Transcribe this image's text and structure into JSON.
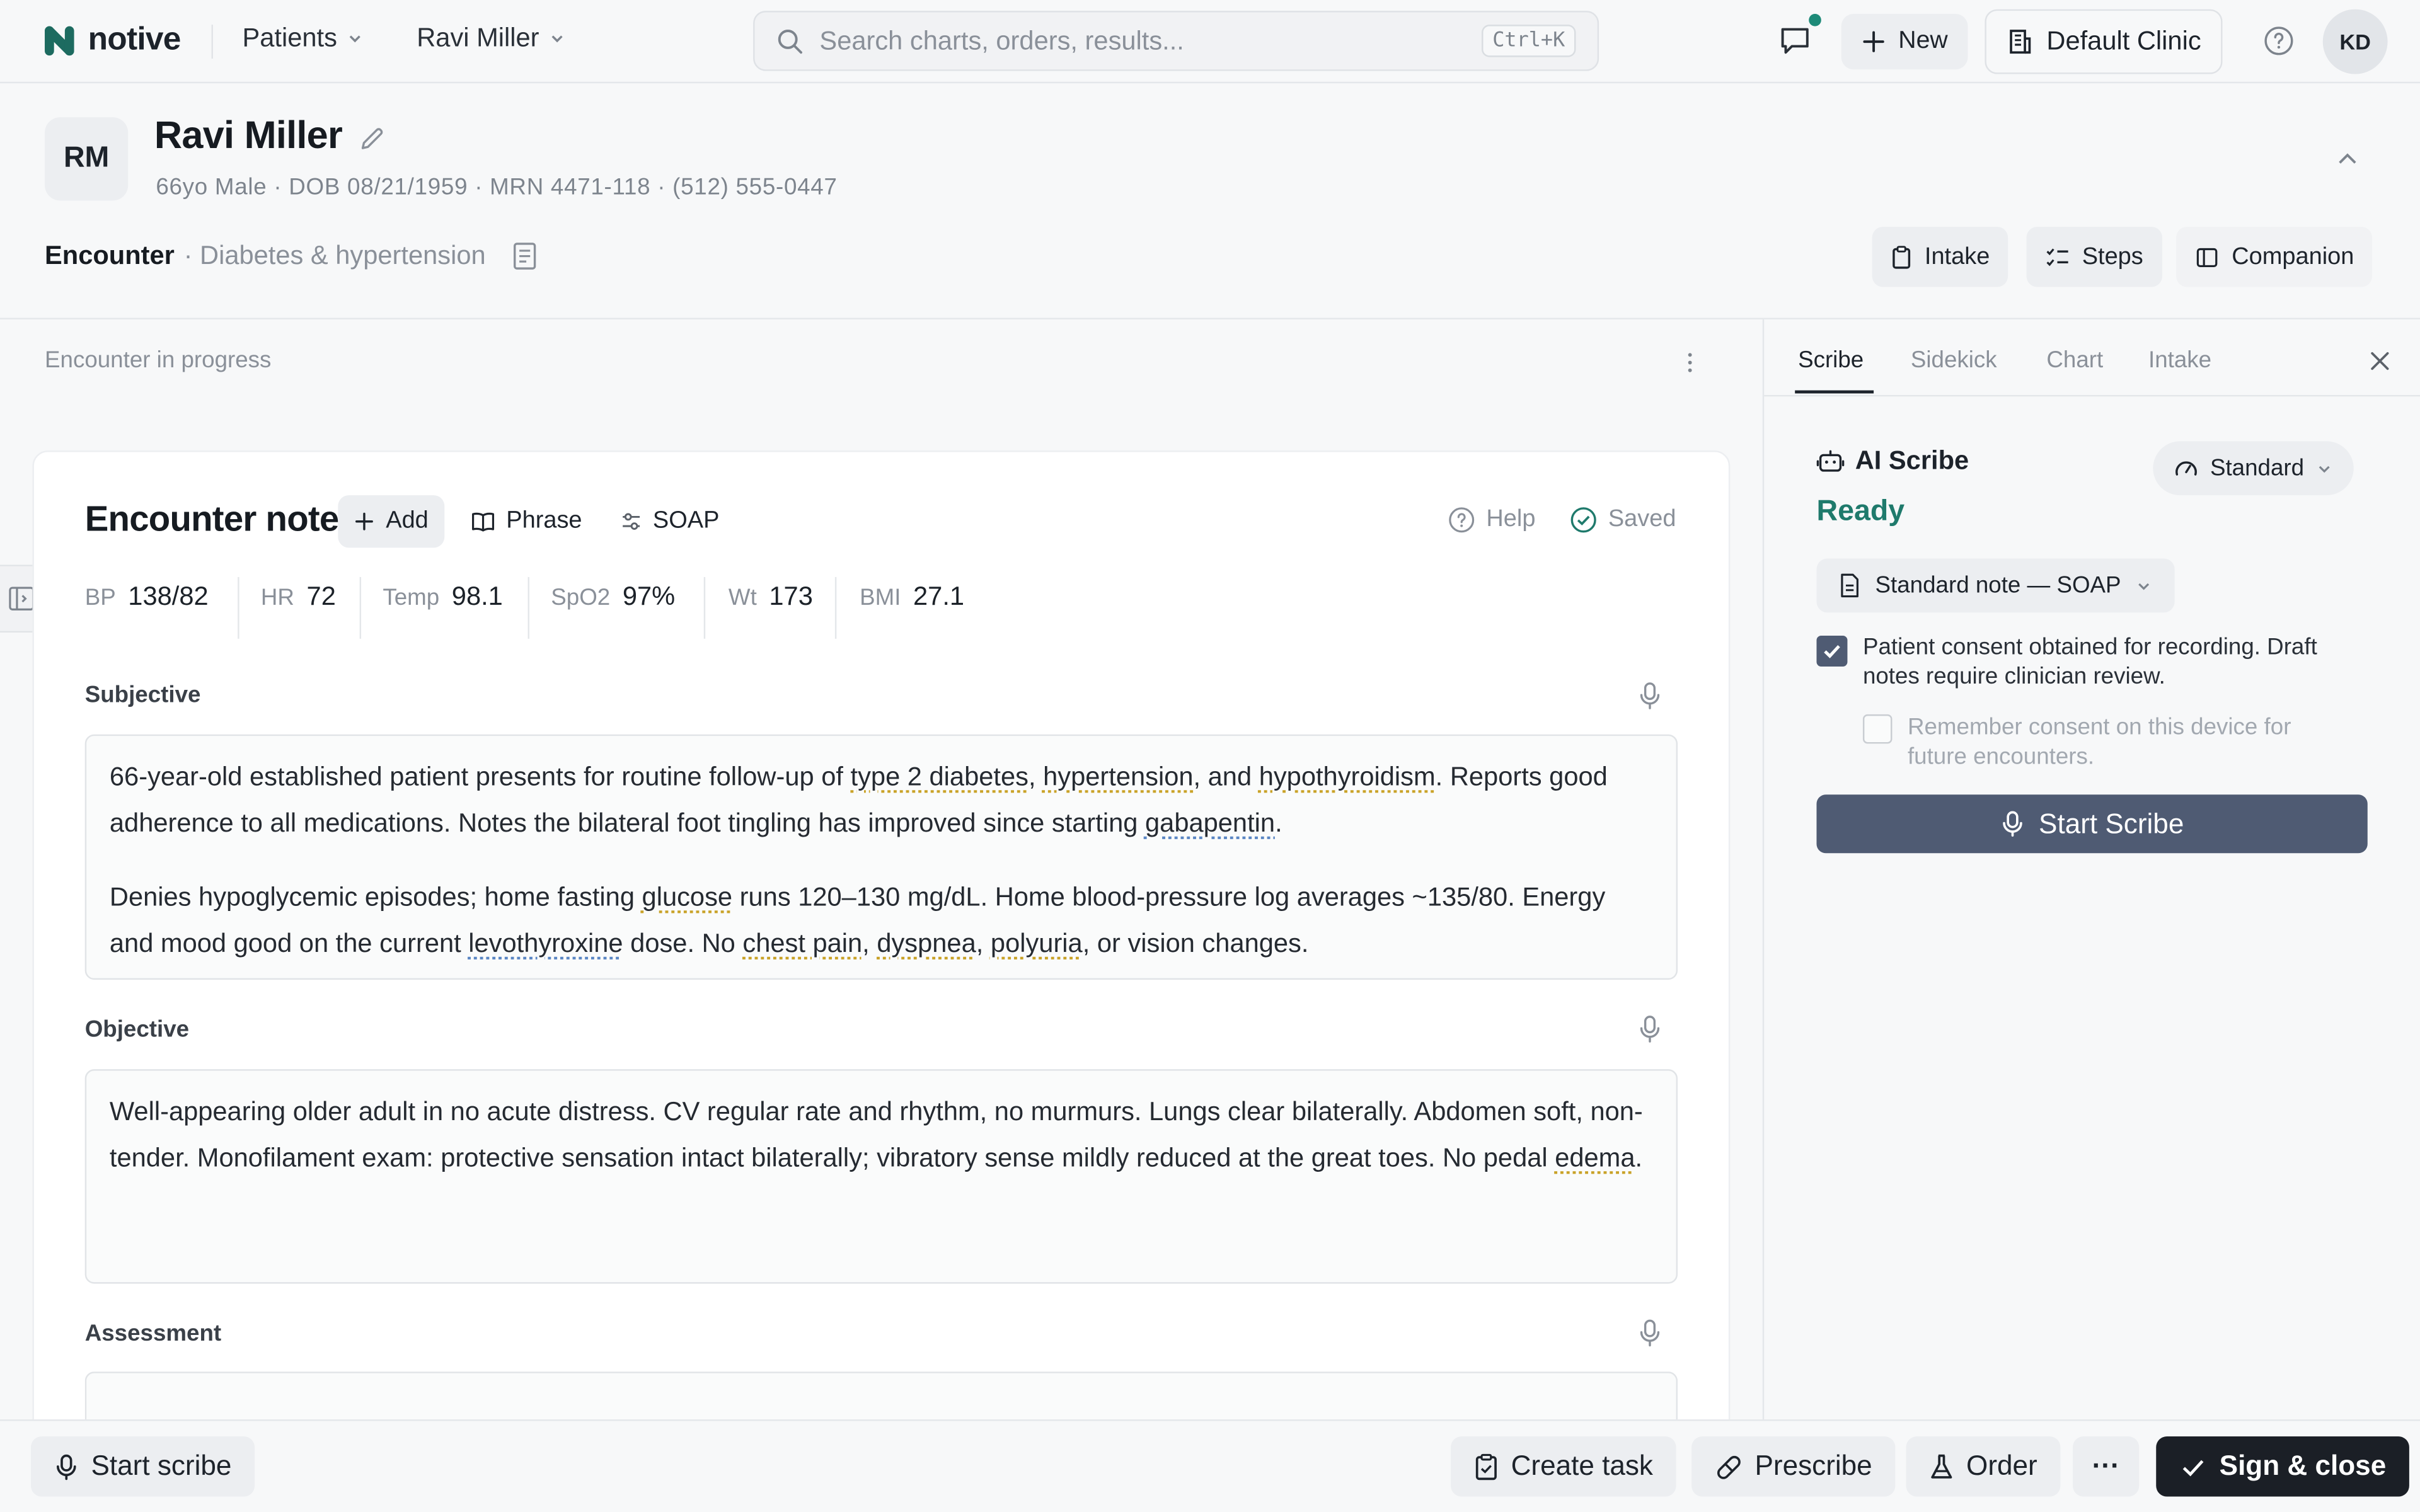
{
  "app": {
    "brand": "notive"
  },
  "nav": {
    "patients_label": "Patients",
    "patient_label": "Ravi Miller",
    "search_placeholder": "Search charts, orders, results...",
    "search_shortcut": "Ctrl+K",
    "new_label": "New",
    "clinic_label": "Default Clinic",
    "user_initials": "KD"
  },
  "patient": {
    "initials": "RM",
    "name": "Ravi Miller",
    "meta": "66yo Male · DOB 08/21/1959 · MRN 4471-118 · (512) 555-0447"
  },
  "encounter": {
    "label": "Encounter",
    "reason": "· Diabetes & hypertension",
    "status": "Encounter in progress",
    "actions": {
      "intake": "Intake",
      "steps": "Steps",
      "companion": "Companion"
    }
  },
  "note": {
    "title": "Encounter note",
    "add_label": "Add",
    "phrase_label": "Phrase",
    "soap_label": "SOAP",
    "help_label": "Help",
    "saved_label": "Saved",
    "vitals": [
      {
        "label": "BP",
        "value": "138/82"
      },
      {
        "label": "HR",
        "value": "72"
      },
      {
        "label": "Temp",
        "value": "98.1"
      },
      {
        "label": "SpO2",
        "value": "97%"
      },
      {
        "label": "Wt",
        "value": "173"
      },
      {
        "label": "BMI",
        "value": "27.1"
      }
    ],
    "sections": {
      "subjective": {
        "title": "Subjective",
        "p1": {
          "t1": "66-year-old established patient presents for routine follow-up of ",
          "k1": "type 2 diabetes",
          "t2": ", ",
          "k2": "hypertension",
          "t3": ", and ",
          "k3": "hypothyroidism",
          "t4": ". Reports good adherence to all medications. Notes the bilateral foot tingling has improved since starting ",
          "k4": "gabapentin",
          "t5": "."
        },
        "p2": {
          "t1": "Denies hypoglycemic episodes; home fasting ",
          "k1": "glucose",
          "t2": " runs 120–130 mg/dL. Home blood-pressure log averages ~135/80. Energy and mood good on the current ",
          "k2": "levothyroxine",
          "t3": " dose. No ",
          "k3": "chest pain",
          "t4": ", ",
          "k4": "dyspnea",
          "t5": ", ",
          "k5": "polyuria",
          "t6": ", or vision changes."
        }
      },
      "objective": {
        "title": "Objective",
        "t1": "Well-appearing older adult in no acute distress. CV regular rate and rhythm, no murmurs. Lungs clear bilaterally. Abdomen soft, non-tender. Monofilament exam: protective sensation intact bilaterally; vibratory sense mildly reduced at the great toes. No pedal ",
        "k1": "edema",
        "t2": "."
      },
      "assessment": {
        "title": "Assessment"
      }
    }
  },
  "panel": {
    "tabs": [
      "Scribe",
      "Sidekick",
      "Chart",
      "Intake"
    ],
    "active_tab": "Scribe",
    "scribe_title": "AI Scribe",
    "status": "Ready",
    "mode_label": "Standard",
    "template_label": "Standard note — SOAP",
    "consent_text": "Patient consent obtained for recording. Draft notes require clinician review.",
    "consent_checked": true,
    "remember_text": "Remember consent on this device for future encounters.",
    "remember_checked": false,
    "start_label": "Start Scribe"
  },
  "footer": {
    "start_scribe": "Start scribe",
    "create_task": "Create task",
    "prescribe": "Prescribe",
    "order": "Order",
    "more": "···",
    "sign_close": "Sign & close"
  },
  "colors": {
    "brand": "#1d6b60",
    "ready": "#1f7a6c",
    "primary_dark": "#4f5b73",
    "sign_button": "#1b1f26",
    "notification_dot": "#1d8a78"
  }
}
